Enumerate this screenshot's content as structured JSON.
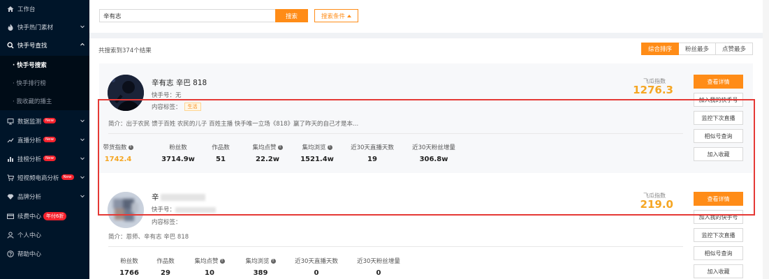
{
  "sidebar": {
    "items": [
      {
        "label": "工作台",
        "icon": "home-icon"
      },
      {
        "label": "快手热门素材",
        "icon": "fire-icon"
      },
      {
        "label": "快手号查找",
        "icon": "search-icon"
      },
      {
        "label": "数据监测",
        "icon": "monitor-icon",
        "badge": "New"
      },
      {
        "label": "直播分析",
        "icon": "trend-icon",
        "badge": "New"
      },
      {
        "label": "挂榜分析",
        "icon": "bar-icon",
        "badge": "New"
      },
      {
        "label": "短视频电商分析",
        "icon": "cart-icon",
        "badge": "New"
      },
      {
        "label": "品牌分析",
        "icon": "diamond-icon"
      },
      {
        "label": "续费中心",
        "icon": "card-icon",
        "badge": "年付6折"
      },
      {
        "label": "个人中心",
        "icon": "user-icon"
      },
      {
        "label": "帮助中心",
        "icon": "help-icon"
      }
    ],
    "sub_items": [
      "· 快手号搜索",
      "· 快手排行榜",
      "· 我收藏的播主"
    ]
  },
  "search": {
    "value": "辛有志",
    "button_label": "搜索",
    "filter_label": "搜索条件"
  },
  "results": {
    "count_text": "共搜索到374个结果",
    "sort": [
      "综合排序",
      "粉丝最多",
      "点赞最多"
    ]
  },
  "cards": [
    {
      "name": "辛有志 辛巴 818",
      "kuaishou_label": "快手号：",
      "kuaishou_value": "无",
      "tag_label": "内容标签：",
      "tag_value": "生活",
      "intro": "简介：出于农民 馈于百姓 农民的儿子 百姓主播 快手唯一立场《818》赢了昨天的自己才是本...",
      "index_label": "飞瓜指数",
      "index_value": "1276.3",
      "stats": [
        {
          "label": "带货指数",
          "value": "1742.4"
        },
        {
          "label": "粉丝数",
          "value": "3714.9w"
        },
        {
          "label": "作品数",
          "value": "51"
        },
        {
          "label": "集均点赞",
          "value": "22.2w"
        },
        {
          "label": "集均浏览",
          "value": "1521.4w"
        },
        {
          "label": "近30天直播天数",
          "value": "19"
        },
        {
          "label": "近30天粉丝增量",
          "value": "306.8w"
        }
      ],
      "actions": [
        "查看详情",
        "加入我的快手号",
        "监控下次直播",
        "相似号查询",
        "加入收藏"
      ]
    },
    {
      "name": "辛",
      "kuaishou_label": "快手号：",
      "tag_label": "内容标签：",
      "intro": "简介：恩师、辛有志 辛巴 818",
      "index_label": "飞瓜指数",
      "index_value": "219.0",
      "stats": [
        {
          "label": "粉丝数",
          "value": "1766"
        },
        {
          "label": "作品数",
          "value": "29"
        },
        {
          "label": "集均点赞",
          "value": "10"
        },
        {
          "label": "集均浏览",
          "value": "389"
        },
        {
          "label": "近30天直播天数",
          "value": "0"
        },
        {
          "label": "近30天粉丝增量",
          "value": "0"
        }
      ],
      "actions": [
        "查看详情",
        "加入我的快手号",
        "监控下次直播",
        "相似号查询",
        "加入收藏"
      ]
    }
  ],
  "colors": {
    "accent": "#ff8c17",
    "sidebar_bg": "#001529",
    "highlight_border": "#e53935",
    "index_value": "#f5a623"
  }
}
